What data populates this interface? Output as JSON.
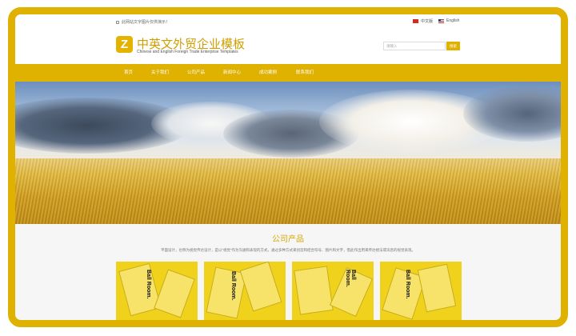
{
  "topbar": {
    "notice": "此网站文字图片仅供演示！",
    "lang_cn": "中文版",
    "lang_en": "English"
  },
  "header": {
    "logo_letter": "Z",
    "title_cn": "中英文外贸企业模板",
    "title_en": "Chinese and English Foreign Trade Enterprise Templates"
  },
  "search": {
    "placeholder": "请输入",
    "button": "搜索"
  },
  "nav": {
    "items": [
      "首页",
      "关于我们",
      "公司产品",
      "新闻中心",
      "成功案例",
      "联系我们"
    ]
  },
  "products": {
    "title": "公司产品",
    "description": "平面设计，也称为视觉传达设计，是以“视觉”作为沟通和表现的方式，通过多种方式来创造和结合符号、图片和文字，借此作出用来传达想法或讯息的视觉表现。",
    "card_text": "Ball Room."
  },
  "colors": {
    "accent": "#dfb100",
    "title": "#d8a800"
  }
}
